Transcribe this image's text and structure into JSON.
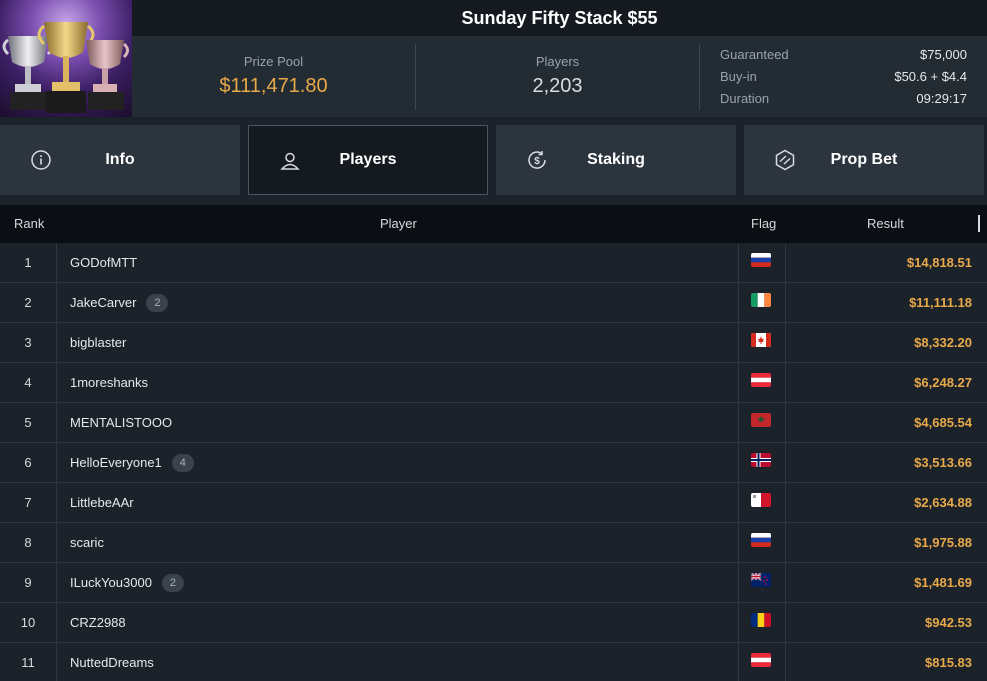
{
  "header": {
    "title": "Sunday Fifty Stack $55",
    "prize_pool_label": "Prize Pool",
    "prize_pool_value": "$111,471.80",
    "players_label": "Players",
    "players_value": "2,203",
    "details": [
      {
        "key": "Guaranteed",
        "value": "$75,000"
      },
      {
        "key": "Buy-in",
        "value": "$50.6 + $4.4"
      },
      {
        "key": "Duration",
        "value": "09:29:17"
      }
    ]
  },
  "tabs": [
    {
      "label": "Info",
      "icon": "info-icon",
      "active": false
    },
    {
      "label": "Players",
      "icon": "user-icon",
      "active": true
    },
    {
      "label": "Staking",
      "icon": "dollar-cycle-icon",
      "active": false
    },
    {
      "label": "Prop Bet",
      "icon": "prop-bet-icon",
      "active": false
    }
  ],
  "table": {
    "columns": {
      "rank": "Rank",
      "player": "Player",
      "flag": "Flag",
      "result": "Result"
    },
    "rows": [
      {
        "rank": "1",
        "player": "GODofMTT",
        "badge": "",
        "flag": "russia",
        "result": "$14,818.51"
      },
      {
        "rank": "2",
        "player": "JakeCarver",
        "badge": "2",
        "flag": "ireland",
        "result": "$11,111.18"
      },
      {
        "rank": "3",
        "player": "bigblaster",
        "badge": "",
        "flag": "canada",
        "result": "$8,332.20"
      },
      {
        "rank": "4",
        "player": "1moreshanks",
        "badge": "",
        "flag": "austria",
        "result": "$6,248.27"
      },
      {
        "rank": "5",
        "player": "MENTALISTOOO",
        "badge": "",
        "flag": "morocco",
        "result": "$4,685.54"
      },
      {
        "rank": "6",
        "player": "HelloEveryone1",
        "badge": "4",
        "flag": "norway",
        "result": "$3,513.66"
      },
      {
        "rank": "7",
        "player": "LittlebeAAr",
        "badge": "",
        "flag": "malta",
        "result": "$2,634.88"
      },
      {
        "rank": "8",
        "player": "scaric",
        "badge": "",
        "flag": "russia",
        "result": "$1,975.88"
      },
      {
        "rank": "9",
        "player": "ILuckYou3000",
        "badge": "2",
        "flag": "new-zealand",
        "result": "$1,481.69"
      },
      {
        "rank": "10",
        "player": "CRZ2988",
        "badge": "",
        "flag": "romania",
        "result": "$942.53"
      },
      {
        "rank": "11",
        "player": "NuttedDreams",
        "badge": "",
        "flag": "austria",
        "result": "$815.83"
      }
    ]
  },
  "colors": {
    "accent": "#e8a94a",
    "background": "#1c2229",
    "header_bg": "#0b0e12"
  }
}
